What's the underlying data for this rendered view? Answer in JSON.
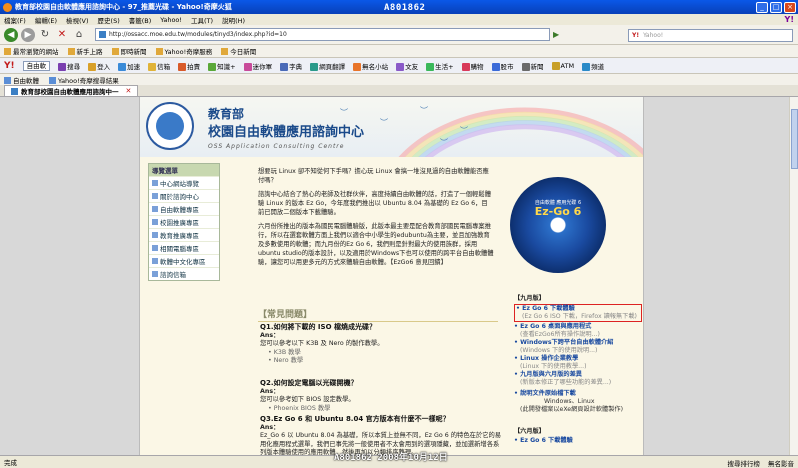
{
  "window": {
    "title": "教育部校園自由軟體應用諮詢中心 - 97_推薦光碟 - Yahoo!奇摩火狐",
    "watermark_top": "A801862"
  },
  "menu": [
    "檔案(F)",
    "編輯(E)",
    "檢視(V)",
    "歷史(S)",
    "書籤(B)",
    "Yahoo!",
    "工具(T)",
    "說明(H)"
  ],
  "nav": {
    "address": "http://ossacc.moe.edu.tw/modules/tinyd3/index.php?id=10",
    "search_placeholder": "Yahoo!"
  },
  "favorites": [
    "最常瀏覽的網站",
    "新手上路",
    "即時新聞",
    "Yahoo!奇摩服務",
    "今日新聞"
  ],
  "yahoo_toolbar": {
    "logo": "Y!",
    "select": "自由軟",
    "items": [
      "搜尋",
      "登入",
      "加速",
      "信箱",
      "拍賣",
      "知識+",
      "迷你軍",
      "字典",
      "網頁翻譯",
      "無名小站",
      "文友",
      "生活+",
      "購物",
      "股市",
      "新聞",
      "ATM",
      "頻道"
    ]
  },
  "links_bar": [
    "自由軟體",
    "Yahoo!奇摩搜尋結果"
  ],
  "tab": {
    "label": "教育部校園自由軟體應用諮詢中一"
  },
  "banner": {
    "title1": "教育部",
    "title2": "校園自由軟體應用諮詢中心",
    "subtitle": "OSS Application Consulting Centre"
  },
  "left_nav": {
    "header": "導覽選單",
    "items": [
      "中心網站導覽",
      "關於諮詢中心",
      "自由軟體專區",
      "校園推廣專區",
      "教育推廣專區",
      "相關電腦專區",
      "軟體中文化專區",
      "諮詢信箱"
    ]
  },
  "intro": {
    "p1": "想要玩 Linux 卻不知從何下手嗎？擔心玩 Linux 會搞一堆沒見過的自由軟體能否應付嗎？",
    "p2": "諮詢中心結合了熱心的老師及社群伙伴，高度持續自由軟體的話，打造了一個輕鬆體驗 Linux 的版本 Ez Go，今年度我們推出以 Ubuntu 8.04 為基礎的 Ez Go 6，目前已開放二個版本下載體驗。",
    "p3": "六月份所推出的版本為國民電腦體驗版，此版本最主要是配合教育部國民電腦專案推行，所以在選套軟體方面上我們以適合中小學生的edubuntu為主要，並且加強教育及多數使用的軟體；而九月份的Ez Go 6，我們則是針對最大的使用族群，採用ubuntu studio的版本設計，以及適用於Windows下也可以使用的跨平台自由軟體體驗，讓您可以用更多元的方式來體驗自由軟體。【EzGo6 意見回饋】"
  },
  "disc": {
    "line1": "自由軟體 應用光碟 6",
    "line2": "Ez-Go 6"
  },
  "faq": {
    "header": "【常見問題】",
    "items": [
      {
        "q": "Q1.如何將下載的 ISO 檔燒成光碟？",
        "ans": "Ans：",
        "text": "您可以參考以下 K3B 及 Nero 的製作教學。",
        "bullets": [
          "K3B 教學",
          "Nero 教學"
        ]
      },
      {
        "q": "Q2.如何設定電腦以光碟開機？",
        "ans": "Ans：",
        "text": "您可以參考如下 BIOS 設定教學。",
        "bullets": [
          "Phoenix BIOS 教學"
        ]
      },
      {
        "q": "Q3.Ez Go 6 和 Ubuntu 8.04 官方版本有什麼不一樣呢？",
        "ans": "Ans：",
        "text": "Ez_Go 6 以 Ubuntu 8.04 為基礎，所以本質上並無不同，Ez Go 6 的特色在於它的易用化應用程式選單，我們已事先將一般使用者不太會用到的選項隱藏，並加選新增各系列版本體驗使用的應用軟體，然後再加以分類排序整理。"
      }
    ]
  },
  "right_links": {
    "header_sep": "【九月版】",
    "items": [
      {
        "label": "Ez Go 6 下載體驗",
        "sub": "(Ez Go 6 ISO 下載，Firefox 讀報無下載)",
        "highlight": true
      },
      {
        "label": "Ez Go 6 桌面與應用程式",
        "sub": "(查看EzGo6所有操作說明...)"
      },
      {
        "label": "Windows下跨平台自由軟體介紹",
        "sub": "(Windows 下的使用說明...)"
      },
      {
        "label": "Linux 操作企業教學",
        "sub": "(Linux 下的使用教學...)"
      },
      {
        "label": "九月版與六月版的差異",
        "sub": "(新版本修正了哪些功能的差異...)"
      },
      {
        "label": "說明文件原始檔下載",
        "sub": "Windows、Linux",
        "sub2": "(此開發檔案以eXe網頁設計軟體製作)"
      }
    ],
    "header_jun": "【六月版】",
    "jun_items": [
      {
        "label": "Ez Go 6 下載體驗"
      }
    ]
  },
  "status": {
    "left": "完成",
    "watermark_bottom": "A801862  2008年10月12日",
    "right1": "搜尋排行榜",
    "right2": "無名影音"
  }
}
